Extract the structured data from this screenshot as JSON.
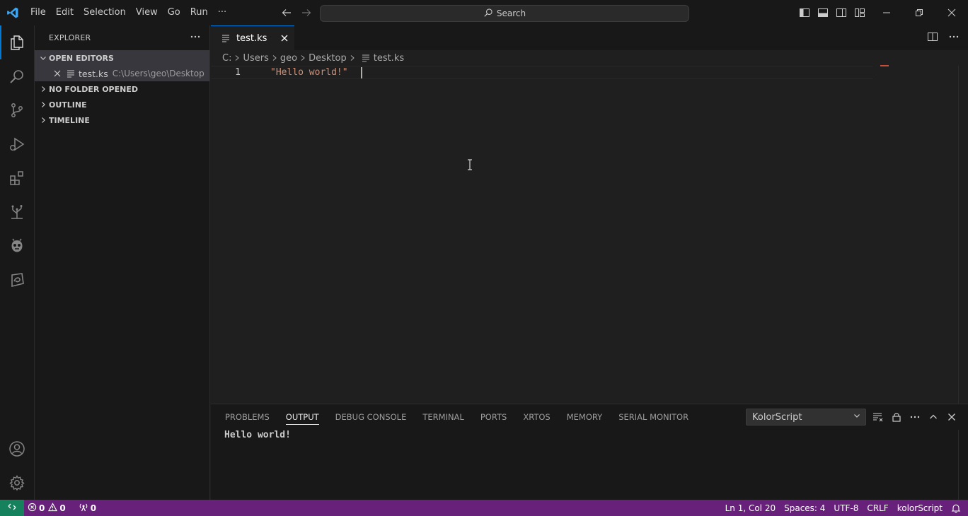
{
  "menu": [
    "File",
    "Edit",
    "Selection",
    "View",
    "Go",
    "Run",
    "···"
  ],
  "search": {
    "label": "Search"
  },
  "sidebar": {
    "title": "EXPLORER",
    "open_editors": {
      "header": "OPEN EDITORS",
      "items": [
        {
          "name": "test.ks",
          "path": "C:\\Users\\geo\\Desktop"
        }
      ]
    },
    "sections": [
      "NO FOLDER OPENED",
      "OUTLINE",
      "TIMELINE"
    ]
  },
  "editor": {
    "tab": {
      "name": "test.ks"
    },
    "breadcrumbs": [
      "C:",
      "Users",
      "geo",
      "Desktop",
      "test.ks"
    ],
    "lines": [
      {
        "number": "1",
        "string": "\"Hello world!\"",
        "rest": "  ."
      }
    ]
  },
  "panel": {
    "tabs": [
      "PROBLEMS",
      "OUTPUT",
      "DEBUG CONSOLE",
      "TERMINAL",
      "PORTS",
      "XRTOS",
      "MEMORY",
      "SERIAL MONITOR"
    ],
    "active_tab": "OUTPUT",
    "channel": "KolorScript",
    "output": "Hello world!"
  },
  "statusbar": {
    "errors": "0",
    "warnings": "0",
    "ports": "0",
    "position": "Ln 1, Col 20",
    "spaces": "Spaces: 4",
    "encoding": "UTF-8",
    "eol": "CRLF",
    "language": "kolorScript",
    "color": "#68217a",
    "remote_color": "#16825d"
  },
  "colors": {
    "accent": "#0078d4",
    "string": "#ce9178"
  }
}
